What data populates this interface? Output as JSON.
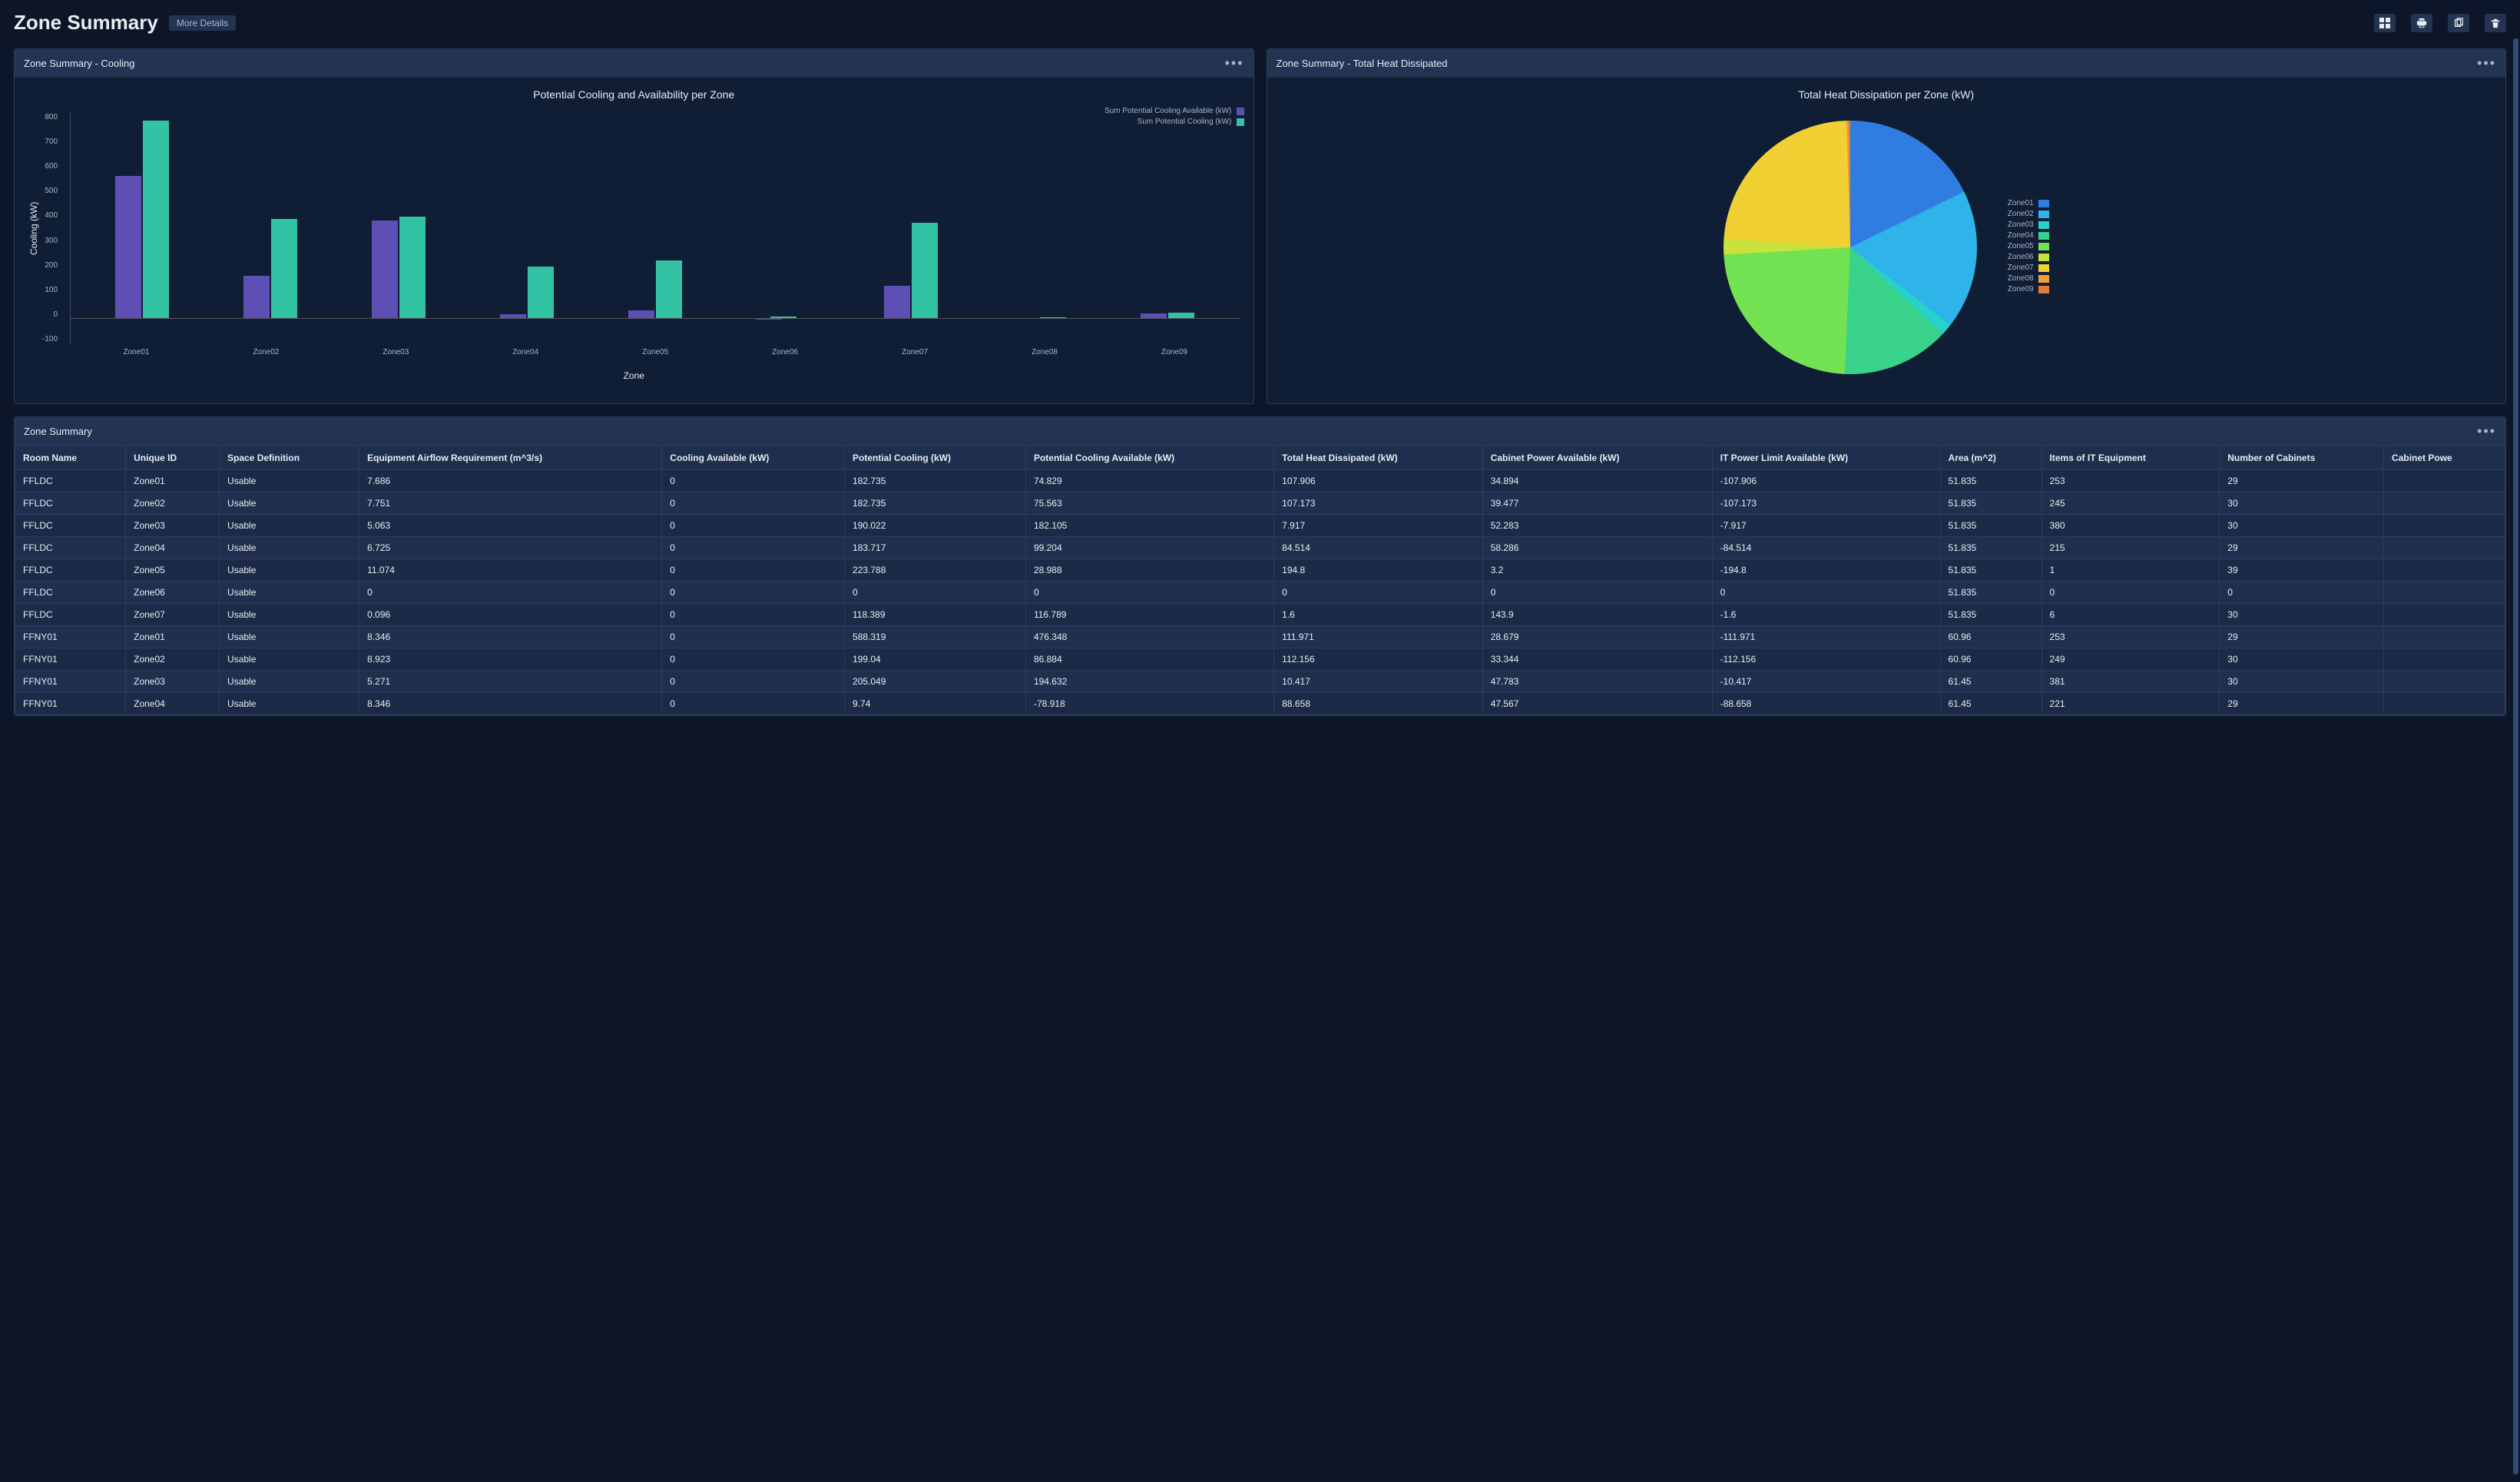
{
  "header": {
    "title": "Zone Summary",
    "more_details": "More Details"
  },
  "toolbar_icons": {
    "dashboard": "dashboard-icon",
    "print": "print-icon",
    "copy": "copy-icon",
    "delete": "delete-icon"
  },
  "panel_cooling": {
    "title": "Zone Summary - Cooling"
  },
  "panel_heat": {
    "title": "Zone Summary - Total Heat Dissipated"
  },
  "panel_table": {
    "title": "Zone Summary"
  },
  "chart_data": [
    {
      "type": "bar",
      "title": "Potential Cooling and Availability per Zone",
      "xlabel": "Zone",
      "ylabel": "Cooling (kW)",
      "ylim": [
        -100,
        800
      ],
      "categories": [
        "Zone01",
        "Zone02",
        "Zone03",
        "Zone04",
        "Zone05",
        "Zone06",
        "Zone07",
        "Zone08",
        "Zone09"
      ],
      "series": [
        {
          "name": "Sum Potential Cooling Available (kW)",
          "color": "#5d4fb3",
          "values": [
            555,
            165,
            380,
            15,
            30,
            -8,
            125,
            0,
            18
          ]
        },
        {
          "name": "Sum Potential Cooling (kW)",
          "color": "#33c2a3",
          "values": [
            770,
            385,
            395,
            200,
            225,
            5,
            370,
            3,
            20
          ]
        }
      ],
      "y_ticks": [
        800,
        700,
        600,
        500,
        400,
        300,
        200,
        100,
        0,
        -100
      ]
    },
    {
      "type": "pie",
      "title": "Total Heat Dissipation per Zone (kW)",
      "series": [
        {
          "name": "Zone01",
          "value": 220,
          "color": "#2f7de1"
        },
        {
          "name": "Zone02",
          "value": 220,
          "color": "#2eb4e8"
        },
        {
          "name": "Zone03",
          "value": 18,
          "color": "#27d2c9"
        },
        {
          "name": "Zone04",
          "value": 170,
          "color": "#38d28a"
        },
        {
          "name": "Zone05",
          "value": 290,
          "color": "#72e252"
        },
        {
          "name": "Zone06",
          "value": 25,
          "color": "#c9e23c"
        },
        {
          "name": "Zone07",
          "value": 290,
          "color": "#f0d033"
        },
        {
          "name": "Zone08",
          "value": 3,
          "color": "#f0a033"
        },
        {
          "name": "Zone09",
          "value": 3,
          "color": "#e87a33"
        }
      ]
    }
  ],
  "table": {
    "columns": [
      "Room Name",
      "Unique ID",
      "Space Definition",
      "Equipment Airflow Requirement (m^3/s)",
      "Cooling Available (kW)",
      "Potential Cooling (kW)",
      "Potential Cooling Available (kW)",
      "Total Heat Dissipated (kW)",
      "Cabinet Power Available (kW)",
      "IT Power Limit Available (kW)",
      "Area (m^2)",
      "Items of IT Equipment",
      "Number of Cabinets",
      "Cabinet Powe"
    ],
    "rows": [
      [
        "FFLDC",
        "Zone01",
        "Usable",
        "7.686",
        "0",
        "182.735",
        "74.829",
        "107.906",
        "34.894",
        "-107.906",
        "51.835",
        "253",
        "29",
        ""
      ],
      [
        "FFLDC",
        "Zone02",
        "Usable",
        "7.751",
        "0",
        "182.735",
        "75.563",
        "107.173",
        "39.477",
        "-107.173",
        "51.835",
        "245",
        "30",
        ""
      ],
      [
        "FFLDC",
        "Zone03",
        "Usable",
        "5.063",
        "0",
        "190.022",
        "182.105",
        "7.917",
        "52.283",
        "-7.917",
        "51.835",
        "380",
        "30",
        ""
      ],
      [
        "FFLDC",
        "Zone04",
        "Usable",
        "6.725",
        "0",
        "183.717",
        "99.204",
        "84.514",
        "58.286",
        "-84.514",
        "51.835",
        "215",
        "29",
        ""
      ],
      [
        "FFLDC",
        "Zone05",
        "Usable",
        "11.074",
        "0",
        "223.788",
        "28.988",
        "194.8",
        "3.2",
        "-194.8",
        "51.835",
        "1",
        "39",
        ""
      ],
      [
        "FFLDC",
        "Zone06",
        "Usable",
        "0",
        "0",
        "0",
        "0",
        "0",
        "0",
        "0",
        "51.835",
        "0",
        "0",
        ""
      ],
      [
        "FFLDC",
        "Zone07",
        "Usable",
        "0.096",
        "0",
        "118.389",
        "116.789",
        "1.6",
        "143.9",
        "-1.6",
        "51.835",
        "6",
        "30",
        ""
      ],
      [
        "FFNY01",
        "Zone01",
        "Usable",
        "8.346",
        "0",
        "588.319",
        "476.348",
        "111.971",
        "28.679",
        "-111.971",
        "60.96",
        "253",
        "29",
        ""
      ],
      [
        "FFNY01",
        "Zone02",
        "Usable",
        "8.923",
        "0",
        "199.04",
        "86.884",
        "112.156",
        "33.344",
        "-112.156",
        "60.96",
        "249",
        "30",
        ""
      ],
      [
        "FFNY01",
        "Zone03",
        "Usable",
        "5.271",
        "0",
        "205.049",
        "194.632",
        "10.417",
        "47.783",
        "-10.417",
        "61.45",
        "381",
        "30",
        ""
      ],
      [
        "FFNY01",
        "Zone04",
        "Usable",
        "8.346",
        "0",
        "9.74",
        "-78.918",
        "88.658",
        "47.567",
        "-88.658",
        "61.45",
        "221",
        "29",
        ""
      ]
    ]
  }
}
